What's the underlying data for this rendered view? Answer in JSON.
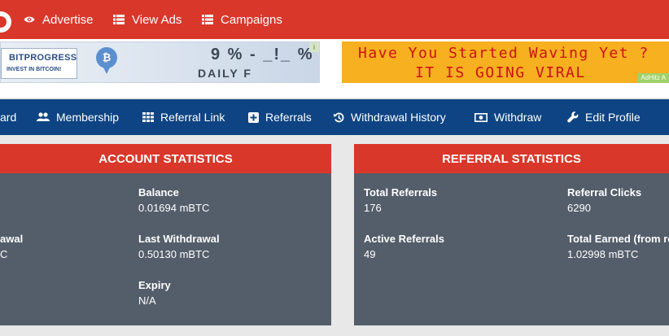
{
  "top_nav": {
    "items": [
      {
        "label": "Advertise",
        "icon": "eye-icon"
      },
      {
        "label": "View Ads",
        "icon": "list-icon"
      },
      {
        "label": "Campaigns",
        "icon": "list-icon"
      }
    ]
  },
  "banners": {
    "left": {
      "brand": "BITPROGRESS",
      "tagline": "INVEST IN BITCOIN!",
      "headline": "9 % - _!_ %",
      "subline": "DAILY F"
    },
    "right": {
      "line1": "Have You Started Waving Yet ?",
      "line2": "IT IS GOING VIRAL",
      "badge": "AdHitz A"
    }
  },
  "sub_nav": {
    "items": [
      {
        "label": "ard"
      },
      {
        "label": "Membership",
        "icon": "users-icon"
      },
      {
        "label": "Referral Link",
        "icon": "grid-icon"
      },
      {
        "label": "Referrals",
        "icon": "plus-square-icon"
      },
      {
        "label": "Withdrawal History",
        "icon": "history-icon"
      },
      {
        "label": "Withdraw",
        "icon": "money-icon"
      },
      {
        "label": "Edit Profile",
        "icon": "wrench-icon"
      }
    ]
  },
  "account_statistics": {
    "title": "ACCOUNT STATISTICS",
    "balance": {
      "label": "Balance",
      "value": "0.01694 mBTC"
    },
    "total_withdrawn_fragment": {
      "label": "awal",
      "value": "C"
    },
    "last_withdrawal": {
      "label": "Last Withdrawal",
      "value": "0.50130 mBTC"
    },
    "expiry": {
      "label": "Expiry",
      "value": "N/A"
    }
  },
  "referral_statistics": {
    "title": "REFERRAL STATISTICS",
    "total_referrals": {
      "label": "Total Referrals",
      "value": "176"
    },
    "referral_clicks": {
      "label": "Referral Clicks",
      "value": "6290"
    },
    "active_referrals": {
      "label": "Active Referrals",
      "value": "49"
    },
    "total_earned": {
      "label": "Total Earned (from re",
      "value": "1.02998 mBTC"
    }
  },
  "colors": {
    "top_nav_bg": "#d9372a",
    "sub_nav_bg": "#0e4483",
    "panel_bg": "#535e6a",
    "panel_header_bg": "#d9372a",
    "page_bg": "#e8e8e8"
  }
}
